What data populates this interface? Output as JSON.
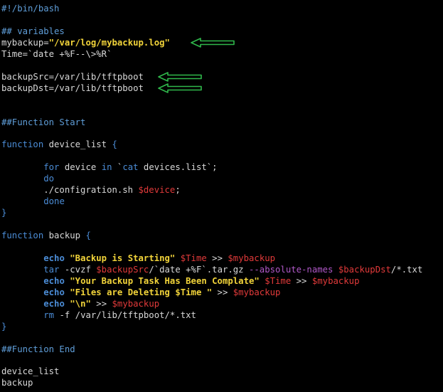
{
  "colors": {
    "background": "#000000",
    "plain": "#d8d8d8",
    "comment": "#5f9ed9",
    "keyword": "#4b8cd6",
    "variable": "#e23a3a",
    "string": "#f2d43a",
    "cmd_keyword": "#4b8cd6",
    "flag": "#b058c8",
    "arrow": "#2fb84b"
  },
  "lines": [
    [
      {
        "t": "#!/bin/bash",
        "c": "comment"
      }
    ],
    [],
    [
      {
        "t": "## variables",
        "c": "comment"
      }
    ],
    [
      {
        "t": "mybackup=",
        "c": "plain"
      },
      {
        "t": "\"/var/log/mybackup.log\"",
        "c": "string",
        "b": true
      }
    ],
    [
      {
        "t": "Time=`date +%F--\\>%R`",
        "c": "plain"
      }
    ],
    [],
    [
      {
        "t": "backupSrc=/var/lib/tftpboot",
        "c": "plain"
      }
    ],
    [
      {
        "t": "backupDst=/var/lib/tftpboot",
        "c": "plain"
      }
    ],
    [],
    [],
    [
      {
        "t": "##Function Start",
        "c": "comment"
      }
    ],
    [],
    [
      {
        "t": "function",
        "c": "keyword"
      },
      {
        "t": " device_list ",
        "c": "plain"
      },
      {
        "t": "{",
        "c": "keyword"
      }
    ],
    [],
    [
      {
        "t": "        ",
        "c": "plain"
      },
      {
        "t": "for",
        "c": "keyword"
      },
      {
        "t": " device ",
        "c": "plain"
      },
      {
        "t": "in",
        "c": "keyword"
      },
      {
        "t": " `",
        "c": "plain"
      },
      {
        "t": "cat",
        "c": "keyword"
      },
      {
        "t": " devices.list`;",
        "c": "plain"
      }
    ],
    [
      {
        "t": "        ",
        "c": "plain"
      },
      {
        "t": "do",
        "c": "keyword"
      }
    ],
    [
      {
        "t": "        ./configration.sh ",
        "c": "plain"
      },
      {
        "t": "$device",
        "c": "variable"
      },
      {
        "t": ";",
        "c": "plain"
      }
    ],
    [
      {
        "t": "        ",
        "c": "plain"
      },
      {
        "t": "done",
        "c": "keyword"
      }
    ],
    [
      {
        "t": "}",
        "c": "keyword"
      }
    ],
    [],
    [
      {
        "t": "function",
        "c": "keyword"
      },
      {
        "t": " backup ",
        "c": "plain"
      },
      {
        "t": "{",
        "c": "keyword"
      }
    ],
    [],
    [
      {
        "t": "        ",
        "c": "plain"
      },
      {
        "t": "echo",
        "c": "keyword",
        "b": true
      },
      {
        "t": " ",
        "c": "plain"
      },
      {
        "t": "\"Backup is Starting\"",
        "c": "string",
        "b": true
      },
      {
        "t": " ",
        "c": "plain"
      },
      {
        "t": "$Time",
        "c": "variable"
      },
      {
        "t": " >> ",
        "c": "plain"
      },
      {
        "t": "$mybackup",
        "c": "variable"
      }
    ],
    [
      {
        "t": "        ",
        "c": "plain"
      },
      {
        "t": "tar",
        "c": "keyword"
      },
      {
        "t": " -cvzf ",
        "c": "plain"
      },
      {
        "t": "$backupSrc",
        "c": "variable"
      },
      {
        "t": "/`date +%F`.tar.gz ",
        "c": "plain"
      },
      {
        "t": "--absolute-names",
        "c": "flag"
      },
      {
        "t": " ",
        "c": "plain"
      },
      {
        "t": "$backupDst",
        "c": "variable"
      },
      {
        "t": "/*.txt",
        "c": "plain"
      }
    ],
    [
      {
        "t": "        ",
        "c": "plain"
      },
      {
        "t": "echo",
        "c": "keyword",
        "b": true
      },
      {
        "t": " ",
        "c": "plain"
      },
      {
        "t": "\"Your Backup Task Has Been Complate\"",
        "c": "string",
        "b": true
      },
      {
        "t": " ",
        "c": "plain"
      },
      {
        "t": "$Time",
        "c": "variable"
      },
      {
        "t": " >> ",
        "c": "plain"
      },
      {
        "t": "$mybackup",
        "c": "variable"
      }
    ],
    [
      {
        "t": "        ",
        "c": "plain"
      },
      {
        "t": "echo",
        "c": "keyword",
        "b": true
      },
      {
        "t": " ",
        "c": "plain"
      },
      {
        "t": "\"Files are Deleting $Time \"",
        "c": "string",
        "b": true
      },
      {
        "t": " >> ",
        "c": "plain"
      },
      {
        "t": "$mybackup",
        "c": "variable"
      }
    ],
    [
      {
        "t": "        ",
        "c": "plain"
      },
      {
        "t": "echo",
        "c": "keyword",
        "b": true
      },
      {
        "t": " ",
        "c": "plain"
      },
      {
        "t": "\"\\n\"",
        "c": "string",
        "b": true
      },
      {
        "t": " >> ",
        "c": "plain"
      },
      {
        "t": "$mybackup",
        "c": "variable"
      }
    ],
    [
      {
        "t": "        ",
        "c": "plain"
      },
      {
        "t": "rm",
        "c": "keyword"
      },
      {
        "t": " -f /var/lib/tftpboot/*.txt",
        "c": "plain"
      }
    ],
    [
      {
        "t": "}",
        "c": "keyword"
      }
    ],
    [],
    [
      {
        "t": "##Function End",
        "c": "comment"
      }
    ],
    [],
    [
      {
        "t": "device_list",
        "c": "plain"
      }
    ],
    [
      {
        "t": "backup",
        "c": "plain"
      }
    ]
  ],
  "annotations": [
    {
      "icon": "green-arrow-left-icon",
      "points_to_line": 4
    },
    {
      "icon": "green-arrow-left-icon",
      "points_to_line": 7
    },
    {
      "icon": "green-arrow-left-icon",
      "points_to_line": 8
    }
  ]
}
